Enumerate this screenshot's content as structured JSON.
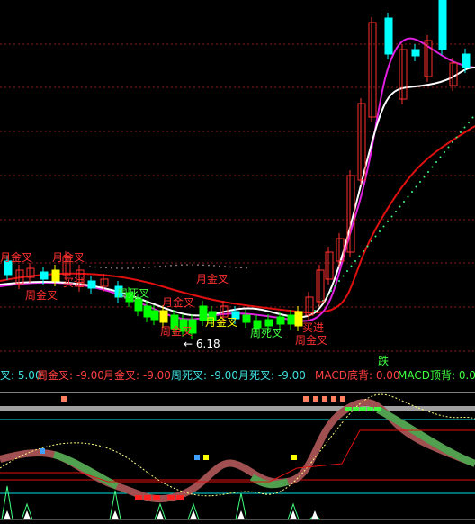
{
  "colors": {
    "background": "#000000",
    "grid": "#8b1a1a",
    "up": "#ff3030",
    "down": "#00ffff",
    "ma_white": "#ffffff",
    "ma_magenta": "#e020e0",
    "ma_red": "#e01010",
    "dots": "#40ff80",
    "label_red": "#ff3030",
    "label_white": "#ffffff",
    "label_green": "#40ff40",
    "label_yellow": "#ffff00",
    "indicator_text_red": "#ff4040",
    "indicator_text_cyan": "#40e0e0",
    "indicator_text_green": "#40ff40"
  },
  "main_panel": {
    "signal_labels": [
      {
        "text": "月金叉",
        "color": "label_red"
      },
      {
        "text": "月金叉",
        "color": "label_red"
      },
      {
        "text": "买进",
        "color": "label_red"
      },
      {
        "text": "周金叉",
        "color": "label_red"
      },
      {
        "text": "月金叉",
        "color": "label_red"
      },
      {
        "text": "月金叉",
        "color": "label_red"
      },
      {
        "text": "周死叉",
        "color": "label_green"
      },
      {
        "text": "周金叉",
        "color": "label_red"
      },
      {
        "text": "月金叉",
        "color": "label_yellow"
      },
      {
        "text": "周死叉",
        "color": "label_green"
      },
      {
        "text": "买进",
        "color": "label_red"
      },
      {
        "text": "周金叉",
        "color": "label_red"
      }
    ],
    "low_marker": "← 6.18"
  },
  "indicator_bar": {
    "items": [
      {
        "label": "叉: 5.00",
        "color": "indicator_text_cyan"
      },
      {
        "label": "周金叉: -9.00",
        "color": "indicator_text_red"
      },
      {
        "label": "月金叉: -9.00",
        "color": "indicator_text_red"
      },
      {
        "label": "周死叉: -9.00",
        "color": "indicator_text_cyan"
      },
      {
        "label": "月死叉: -9.00",
        "color": "indicator_text_cyan"
      },
      {
        "label": "MACD底背: 0.00",
        "color": "indicator_text_red"
      },
      {
        "label": "MACD顶背: 0.00",
        "color": "indicator_text_green"
      }
    ],
    "top_label": "跌"
  }
}
